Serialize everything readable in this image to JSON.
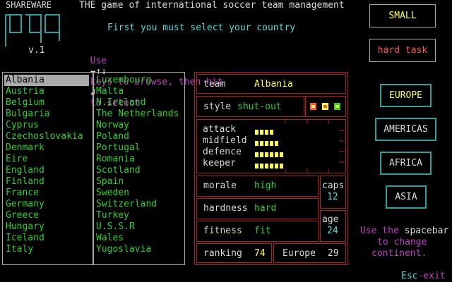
{
  "header": {
    "shareware": "SHAREWARE",
    "version": "v.1",
    "title": "THE game of international soccer team management",
    "instruction": "First you must select your country",
    "browse_use": "Use",
    "browse_arrows": "↔↑↓",
    "browse_text": "keys to browse, then hit",
    "browse_enter": "↲",
    "browse_end": "to select"
  },
  "buttons": {
    "size": "SMALL",
    "difficulty": "hard task"
  },
  "countries_col1": [
    "Albania",
    "Austria",
    "Belgium",
    "Bulgaria",
    "Cyprus",
    "Czechoslovakia",
    "Denmark",
    "Eire",
    "England",
    "Finland",
    "France",
    "Germany",
    "Greece",
    "Hungary",
    "Iceland",
    "Italy"
  ],
  "countries_col2": [
    "Luxembourg",
    "Malta",
    "N.Ireland",
    "The Netherlands",
    "Norway",
    "Poland",
    "Portugal",
    "Romania",
    "Scotland",
    "Spain",
    "Sweden",
    "Switzerland",
    "Turkey",
    "U.S.S.R",
    "Wales",
    "Yugoslavia"
  ],
  "selected_country": "Albania",
  "team_panel": {
    "team_label": "team",
    "team_value": "Albania",
    "style_label": "style",
    "style_value": "shut-out",
    "attack_label": "attack",
    "midfield_label": "midfield",
    "defence_label": "defence",
    "keeper_label": "keeper",
    "attack_level": 4,
    "midfield_level": 5,
    "defence_level": 6,
    "keeper_level": 6,
    "morale_label": "morale",
    "morale_value": "high",
    "hardness_label": "hardness",
    "hardness_value": "hard",
    "fitness_label": "fitness",
    "fitness_value": "fit",
    "caps_label": "caps",
    "caps_value": "12",
    "age_label": "age",
    "age_value": "24",
    "ranking_label": "ranking",
    "ranking_value": "74",
    "europe_label": "Europe",
    "europe_value": "29"
  },
  "continents": [
    "EUROPE",
    "AMERICAS",
    "AFRICA",
    "ASIA"
  ],
  "selected_continent": "EUROPE",
  "continent_hint": {
    "use": "Use the",
    "key": "spacebar",
    "line2": "to change",
    "line3": "continent."
  },
  "exit": {
    "key": "Esc",
    "text": "-exit"
  },
  "colors": {
    "white": "#d8d8d8",
    "cyan": "#55dddd",
    "green": "#2fd02f",
    "yellow": "#ffff55",
    "magenta": "#c040c0",
    "red": "#ff5555",
    "highlight_bg": "#aaaaaa"
  }
}
